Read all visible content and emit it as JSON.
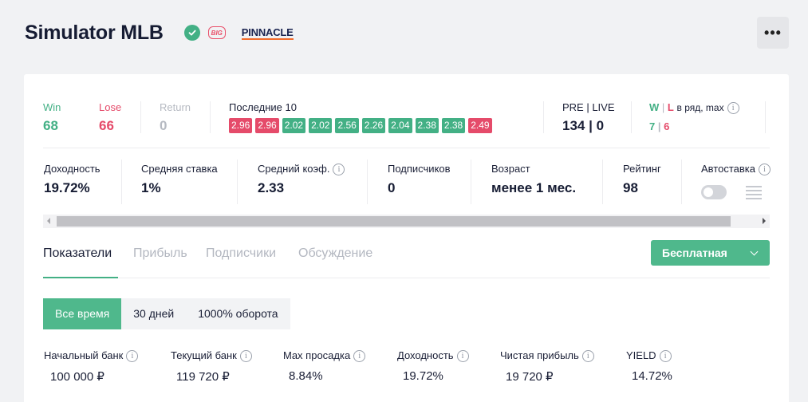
{
  "header": {
    "title": "Simulator MLB",
    "big_badge": "BIG",
    "bookmaker": "PINNACLE",
    "more_label": "•••",
    "verified_icon": "check-circle-icon"
  },
  "colors": {
    "win": "#43b085",
    "lose": "#e54b6a",
    "return": "#b6bac2",
    "accent": "#4fb88c"
  },
  "record": {
    "win_label": "Win",
    "win_value": "68",
    "lose_label": "Lose",
    "lose_value": "66",
    "return_label": "Return",
    "return_value": "0"
  },
  "last10": {
    "label": "Последние 10",
    "results": [
      {
        "odds": "2.96",
        "result": "lose"
      },
      {
        "odds": "2.96",
        "result": "lose"
      },
      {
        "odds": "2.02",
        "result": "win"
      },
      {
        "odds": "2.02",
        "result": "win"
      },
      {
        "odds": "2.56",
        "result": "win"
      },
      {
        "odds": "2.26",
        "result": "win"
      },
      {
        "odds": "2.04",
        "result": "win"
      },
      {
        "odds": "2.38",
        "result": "win"
      },
      {
        "odds": "2.38",
        "result": "win"
      },
      {
        "odds": "2.49",
        "result": "lose"
      }
    ]
  },
  "prelive": {
    "label": "PRE | LIVE",
    "pre": "134",
    "sep": "|",
    "live": "0"
  },
  "streak": {
    "w": "W",
    "sep": "|",
    "l": "L",
    "label_rest": "в ряд, max",
    "w_value": "7",
    "l_value": "6"
  },
  "stats": {
    "yield_label": "Доходность",
    "yield_value": "19.72%",
    "avg_stake_label": "Средняя ставка",
    "avg_stake_value": "1%",
    "avg_odds_label": "Средний коэф.",
    "avg_odds_value": "2.33",
    "subscribers_label": "Подписчиков",
    "subscribers_value": "0",
    "age_label": "Возраст",
    "age_value": "менее 1 мес.",
    "rating_label": "Рейтинг",
    "rating_value": "98",
    "autobet_label": "Автоставка"
  },
  "tabs": [
    "Показатели",
    "Прибыль",
    "Подписчики",
    "Обсуждение"
  ],
  "subscription_button": "Бесплатная",
  "periods": [
    "Все время",
    "30 дней",
    "1000% оборота"
  ],
  "metrics": [
    {
      "label": "Начальный банк",
      "value": "100 000 ₽"
    },
    {
      "label": "Текущий банк",
      "value": "119 720 ₽"
    },
    {
      "label": "Max просадка",
      "value": "8.84%"
    },
    {
      "label": "Доходность",
      "value": "19.72%"
    },
    {
      "label": "Чистая прибыль",
      "value": "19 720 ₽"
    },
    {
      "label": "YIELD",
      "value": "14.72%"
    }
  ]
}
